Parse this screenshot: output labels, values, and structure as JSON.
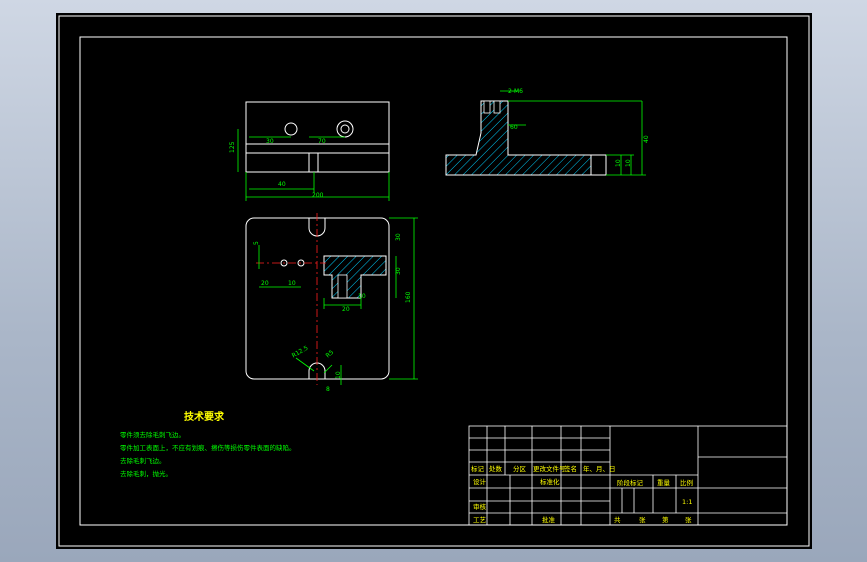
{
  "colors": {
    "background": "#000000",
    "frame": "#ffffff",
    "dimension": "#00ff00",
    "centerline": "#ff2020",
    "hatch": "#00d0ff",
    "tech_text": "#00ff00",
    "titleblock_text": "#ffff00",
    "desktop": "#aab6c8"
  },
  "tech_requirements": {
    "title": "技术要求",
    "lines": [
      "零件须去除毛刺飞边。",
      "零件加工表面上，不应有划痕、擦伤等损伤零件表面的缺陷。",
      "去除毛刺飞边。",
      "去除毛刺，抛光。"
    ]
  },
  "title_block": {
    "header": [
      "标记",
      "处数",
      "分区",
      "更改文件号",
      "签名",
      "年、月、日"
    ],
    "design": "设计",
    "standardize": "标准化",
    "review": "审核",
    "process": "工艺",
    "approve": "批准",
    "stage_mark": "阶段标记",
    "weight": "重量",
    "scale_label": "比例",
    "scale_value": "1:1",
    "sheet_total": "共",
    "sheet_word1": "张",
    "sheet_no": "第",
    "sheet_word2": "张"
  },
  "dimensions": {
    "top_view": [
      "125",
      "30",
      "70",
      "40",
      "200"
    ],
    "side_view": [
      "40",
      "10",
      "10",
      "60",
      "2-M6"
    ],
    "front_view": [
      "5",
      "20",
      "10",
      "30",
      "30",
      "160",
      "10",
      "20",
      "R5",
      "R12.5",
      "10",
      "8"
    ]
  }
}
